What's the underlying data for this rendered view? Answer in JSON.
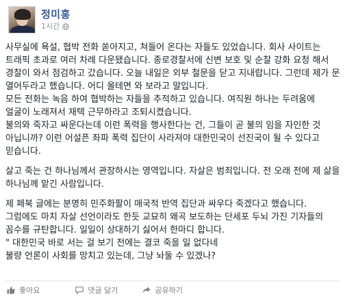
{
  "post": {
    "author": "정미홍",
    "timestamp": "1시간",
    "paragraphs": [
      "사무실에 욕설, 협박 전화 쏟아지고, 쳐들어 온다는 자들도 있었습니다. 회사 사이트는 트래픽 초과로 여러 차례 다운됐습니다. 종로경찰서에 신변 보호 및 순찰 강화 요청 해서 경찰이 와서 점검하고 갔습니다. 오늘 내일은 외부 철문을 닫고 지내랍니다. 그런데 제가 문 열어두라고 했습니다. 어디 올테면 와 보라고 말입니다.\n모든 전화는 녹음 하여 협박하는 자들을 추적하고 있습니다. 여직원 하나는 두려움에 얼굴이 노래져서 재택 근무하라고 조퇴시켰습니다.\n불의와 죽자고 싸운다는데 이런 폭력을 행사한다는 건, 그들이 곧 불의 임을 자인한 것 아닙니까? 이런 어설픈 좌파 폭력 집단이 사라져야 대한민국이 선진국이 될 수 있다고 믿습니다.",
      "살고 죽는 건 하나님께서 관장하시는 영역입니다. 자살은 범죄입니다. 전 오래 전에 제 삶을 하나님께 맡긴 사람입니다.",
      "제 페북 글에는 분명히 민주화팔이 매국적 반역 집단과 싸우다 죽겠다고 했습니다. 그럼에도 마치 자살 선언이라도 한듯 교묘히 왜곡 보도하는 단세포 두뇌 가진 기자들의 꼼수를 규탄합니다. 일일이 상대하기 싫어서 한마디 합니다.\n\" 대한민국 바로 서는 걸 보기 전에는 결코 죽을 일 없다네\n불량 언론이 사회를 망치고 있는데, 그냥 놔둘 수 있겠나?"
    ]
  },
  "actions": {
    "like": "좋아요",
    "comment": "댓글 달기",
    "share": "공유하기"
  },
  "colors": {
    "author_link": "#365899",
    "meta_text": "#90949c",
    "body_text": "#1d2129",
    "action_text": "#7f7f7f"
  },
  "icons": {
    "audience": "globe-icon",
    "like": "thumbs-up-icon",
    "comment": "comment-icon",
    "share": "share-arrow-icon"
  }
}
